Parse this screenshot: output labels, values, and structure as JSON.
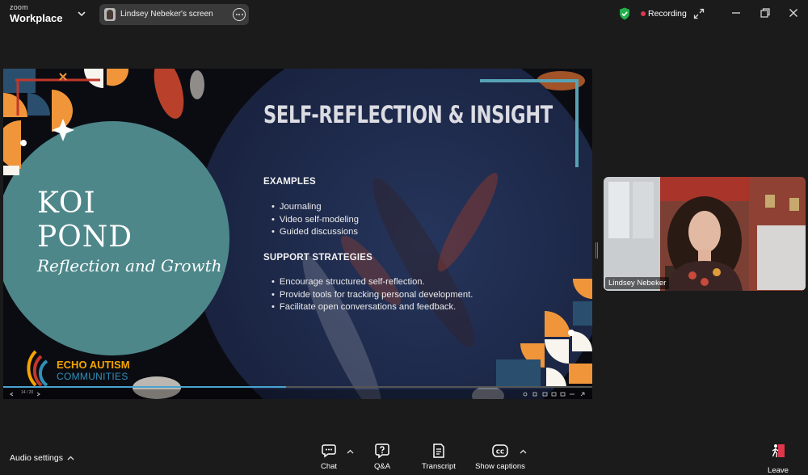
{
  "app": {
    "brand_top": "zoom",
    "brand_bottom": "Workplace"
  },
  "share": {
    "label": "Lindsey Nebeker's screen"
  },
  "status": {
    "recording_label": "Recording"
  },
  "slide": {
    "title": "SELF-REFLECTION & INSIGHT",
    "sections": [
      {
        "heading": "EXAMPLES",
        "items": [
          "Journaling",
          "Video self-modeling",
          "Guided discussions"
        ]
      },
      {
        "heading": "SUPPORT STRATEGIES",
        "items": [
          "Encourage structured self-reflection.",
          "Provide tools for tracking personal development.",
          "Facilitate open conversations and feedback."
        ]
      }
    ],
    "left_title_line1": "KOI",
    "left_title_line2": "POND",
    "left_subtitle": "Reflection and Growth",
    "logo_line1": "ECHO AUTISM",
    "logo_line2": "COMMUNITIES",
    "counter": "14 / 20",
    "progress": 0.48
  },
  "participant": {
    "name": "Lindsey Nebeker"
  },
  "toolbar": {
    "audio_settings": "Audio settings",
    "chat": "Chat",
    "qa": "Q&A",
    "transcript": "Transcript",
    "captions": "Show captions",
    "leave": "Leave"
  },
  "colors": {
    "teal": "#4d878a",
    "navy": "#1d2a4d",
    "orange": "#f0953a",
    "recording_red": "#e0364b",
    "shield_green": "#22b04c",
    "leave_red": "#e0364b"
  },
  "icons": [
    "chevron-down-icon",
    "more-icon",
    "shield-check-icon",
    "expand-icon",
    "minimize-icon",
    "restore-icon",
    "close-icon",
    "chat-icon",
    "qa-icon",
    "transcript-icon",
    "captions-icon",
    "leave-icon"
  ]
}
